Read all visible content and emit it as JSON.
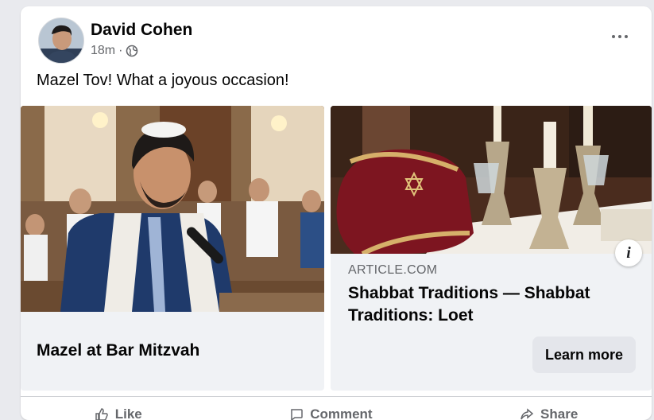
{
  "post": {
    "author": "David Cohen",
    "time": "18m",
    "separator": "·",
    "privacy_icon": "globe-icon",
    "options_icon": "more-options-icon",
    "text": "Mazel Tov! What a joyous occasion!"
  },
  "carousel": [
    {
      "caption": "Mazel at Bar Mitzvah"
    },
    {
      "domain": "ARTICLE.COM",
      "headline": "Shabbat Traditions — Shabbat Traditions: Loet",
      "cta": "Learn more",
      "info_icon": "i"
    }
  ],
  "actions": {
    "like": "Like",
    "comment": "Comment",
    "share": "Share"
  },
  "colors": {
    "background": "#e9eaee",
    "card": "#ffffff",
    "secondary_text": "#65676b",
    "button": "#e4e6eb"
  }
}
